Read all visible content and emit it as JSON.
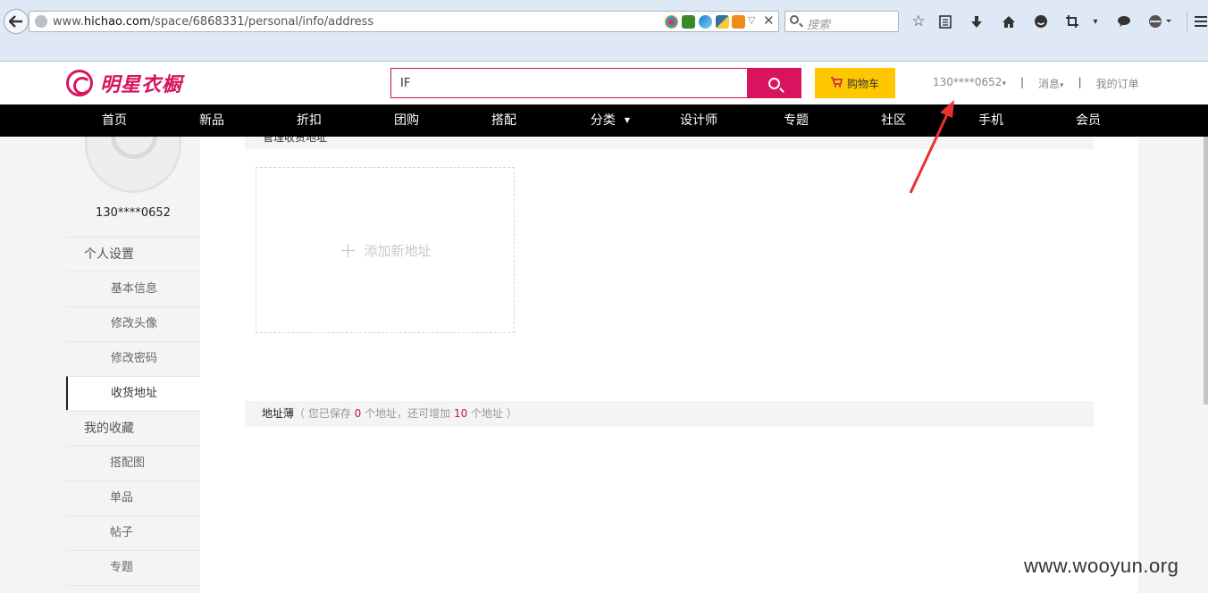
{
  "browser": {
    "url_prefix": "www.",
    "url_domain": "hichao.com",
    "url_path": "/space/6868331/personal/info/address",
    "search_placeholder": "搜索"
  },
  "header": {
    "logo_text": "明星衣橱",
    "search_value": "IF",
    "cart_label": "购物车",
    "user_label": "130****0652",
    "user_caret": "▾",
    "messages_label": "消息",
    "orders_label": "我的订单",
    "separator": "|"
  },
  "nav": {
    "items": [
      "首页",
      "新品",
      "折扣",
      "团购",
      "搭配",
      "分类",
      "设计师",
      "专题",
      "社区",
      "手机",
      "会员"
    ],
    "dropdown_caret": "▼"
  },
  "sidebar": {
    "username": "130****0652",
    "sections": [
      {
        "label": "个人设置",
        "items": [
          "基本信息",
          "修改头像",
          "修改密码",
          "收货地址"
        ]
      },
      {
        "label": "我的收藏",
        "items": [
          "搭配图",
          "单品",
          "帖子",
          "专题"
        ]
      }
    ],
    "active_item": "收货地址"
  },
  "main": {
    "panel_title": "管理收货地址",
    "add_plus": "+",
    "add_address_label": "添加新地址",
    "address_book": {
      "title": "地址薄",
      "text_1": "（ 您已保存 ",
      "saved_count": "0",
      "text_2": " 个地址，还可增加 ",
      "remaining": "10",
      "text_3": " 个地址 ）"
    }
  },
  "watermark": "www.wooyun.org",
  "colors": {
    "brand": "#d8145f",
    "cart": "#ffc700",
    "nav_bg": "#000000"
  }
}
